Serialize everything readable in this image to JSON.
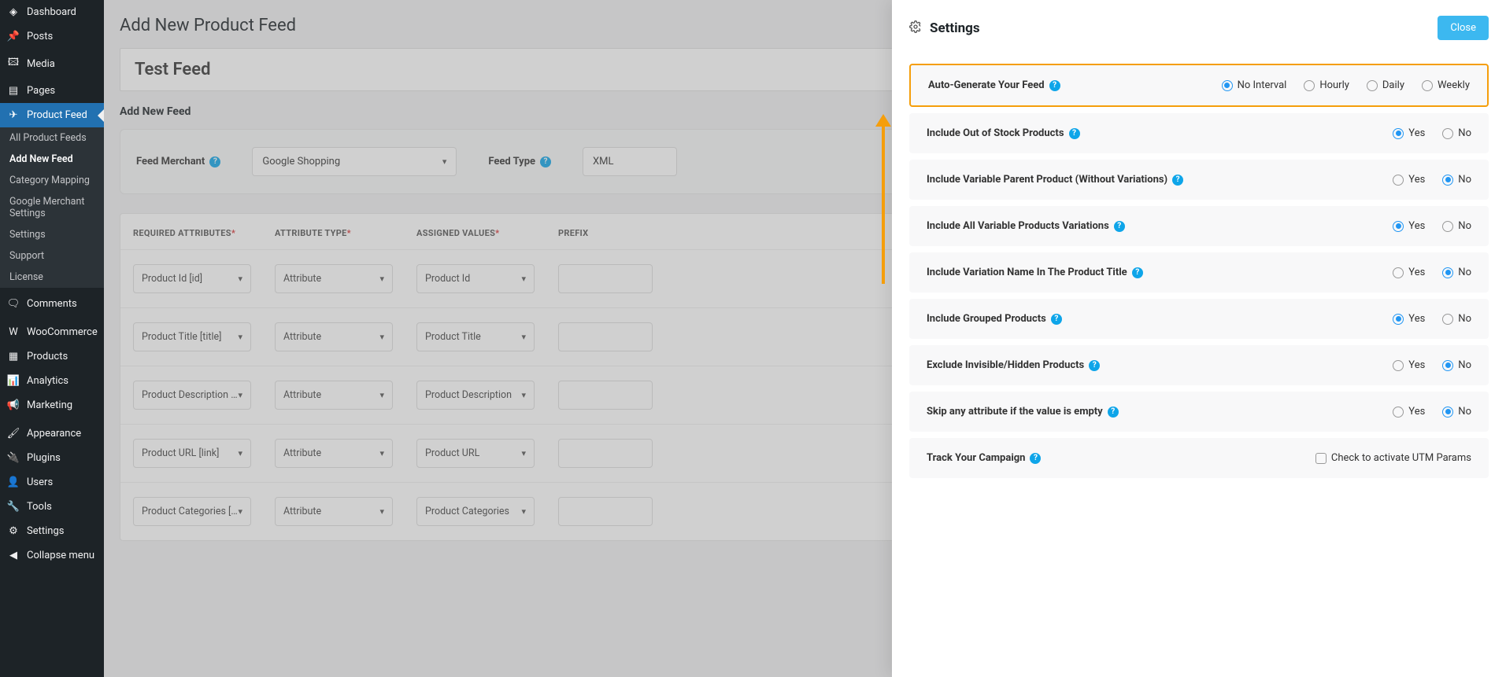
{
  "sidebar": {
    "items": [
      {
        "label": "Dashboard",
        "icon": "dashboard"
      },
      {
        "label": "Posts",
        "icon": "pin"
      },
      {
        "label": "Media",
        "icon": "media"
      },
      {
        "label": "Pages",
        "icon": "pages"
      },
      {
        "label": "Product Feed",
        "icon": "feed",
        "active": true
      },
      {
        "label": "Comments",
        "icon": "comment"
      },
      {
        "label": "WooCommerce",
        "icon": "woo"
      },
      {
        "label": "Products",
        "icon": "products"
      },
      {
        "label": "Analytics",
        "icon": "analytics"
      },
      {
        "label": "Marketing",
        "icon": "marketing"
      },
      {
        "label": "Appearance",
        "icon": "appearance"
      },
      {
        "label": "Plugins",
        "icon": "plugins"
      },
      {
        "label": "Users",
        "icon": "users"
      },
      {
        "label": "Tools",
        "icon": "tools"
      },
      {
        "label": "Settings",
        "icon": "settings"
      },
      {
        "label": "Collapse menu",
        "icon": "collapse"
      }
    ],
    "submenu": [
      "All Product Feeds",
      "Add New Feed",
      "Category Mapping",
      "Google Merchant Settings",
      "Settings",
      "Support",
      "License"
    ]
  },
  "main": {
    "page_title": "Add New Product Feed",
    "feed_name": "Test Feed",
    "section_title": "Add New Feed",
    "merchant_label": "Feed Merchant",
    "merchant_value": "Google Shopping",
    "type_label": "Feed Type",
    "type_value": "XML",
    "headers": {
      "req": "REQUIRED ATTRIBUTES",
      "type": "ATTRIBUTE TYPE",
      "val": "ASSIGNED VALUES",
      "pref": "PREFIX"
    },
    "rows": [
      {
        "req": "Product Id [id]",
        "type": "Attribute",
        "val": "Product Id"
      },
      {
        "req": "Product Title [title]",
        "type": "Attribute",
        "val": "Product Title"
      },
      {
        "req": "Product Description [description]",
        "type": "Attribute",
        "val": "Product Description"
      },
      {
        "req": "Product URL [link]",
        "type": "Attribute",
        "val": "Product URL"
      },
      {
        "req": "Product Categories [product_type]",
        "type": "Attribute",
        "val": "Product Categories"
      }
    ]
  },
  "panel": {
    "title": "Settings",
    "close": "Close",
    "autogen_label": "Auto-Generate Your Feed",
    "autogen_opts": [
      "No Interval",
      "Hourly",
      "Daily",
      "Weekly"
    ],
    "autogen_selected": "No Interval",
    "settings": [
      {
        "label": "Include Out of Stock Products",
        "sel": "Yes"
      },
      {
        "label": "Include Variable Parent Product (Without Variations)",
        "sel": "No"
      },
      {
        "label": "Include All Variable Products Variations",
        "sel": "Yes"
      },
      {
        "label": "Include Variation Name In The Product Title",
        "sel": "No"
      },
      {
        "label": "Include Grouped Products",
        "sel": "Yes"
      },
      {
        "label": "Exclude Invisible/Hidden Products",
        "sel": "No"
      },
      {
        "label": "Skip any attribute if the value is empty",
        "sel": "No"
      }
    ],
    "yes": "Yes",
    "no": "No",
    "track_label": "Track Your Campaign",
    "track_check": "Check to activate UTM Params"
  }
}
